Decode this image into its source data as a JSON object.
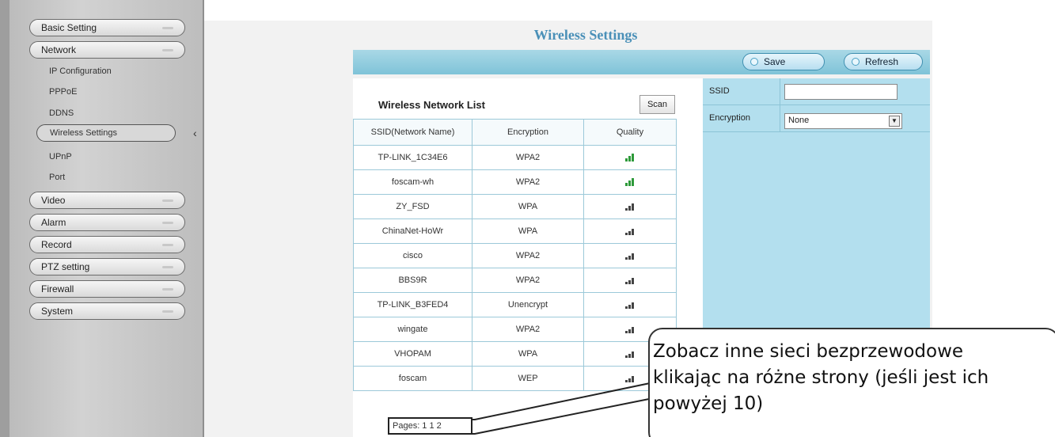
{
  "sidebar": {
    "menu": [
      {
        "label": "Basic Setting"
      },
      {
        "label": "Network"
      },
      {
        "label": "Video"
      },
      {
        "label": "Alarm"
      },
      {
        "label": "Record"
      },
      {
        "label": "PTZ setting"
      },
      {
        "label": "Firewall"
      },
      {
        "label": "System"
      }
    ],
    "network_sub": [
      {
        "label": "IP Configuration"
      },
      {
        "label": "PPPoE"
      },
      {
        "label": "DDNS"
      },
      {
        "label": "Wireless Settings"
      },
      {
        "label": "UPnP"
      },
      {
        "label": "Port"
      }
    ]
  },
  "main": {
    "title": "Wireless Settings",
    "toolbar": {
      "save_label": "Save",
      "refresh_label": "Refresh"
    }
  },
  "network_list": {
    "title": "Wireless Network List",
    "scan_label": "Scan",
    "columns": [
      "SSID(Network Name)",
      "Encryption",
      "Quality"
    ],
    "rows": [
      {
        "ssid": "TP-LINK_1C34E6",
        "encryption": "WPA2",
        "quality": "good"
      },
      {
        "ssid": "foscam-wh",
        "encryption": "WPA2",
        "quality": "good"
      },
      {
        "ssid": "ZY_FSD",
        "encryption": "WPA",
        "quality": "medium"
      },
      {
        "ssid": "ChinaNet-HoWr",
        "encryption": "WPA",
        "quality": "low"
      },
      {
        "ssid": "cisco",
        "encryption": "WPA2",
        "quality": "low"
      },
      {
        "ssid": "BBS9R",
        "encryption": "WPA2",
        "quality": "low"
      },
      {
        "ssid": "TP-LINK_B3FED4",
        "encryption": "Unencrypt",
        "quality": "low"
      },
      {
        "ssid": "wingate",
        "encryption": "WPA2",
        "quality": "low"
      },
      {
        "ssid": "VHOPAM",
        "encryption": "WPA",
        "quality": "low"
      },
      {
        "ssid": "foscam",
        "encryption": "WEP",
        "quality": "low"
      }
    ],
    "pager": "Pages: 1   1 2"
  },
  "settings": {
    "ssid_label": "SSID",
    "ssid_value": "",
    "encryption_label": "Encryption",
    "encryption_value": "None"
  },
  "callout": {
    "line1": "Zobacz inne sieci bezprzewodowe",
    "line2": "klikając na różne strony (jeśli jest ich",
    "line3": "powyżej 10)"
  },
  "colors": {
    "accent": "#4a90b8",
    "toolbar": "#8ccbe0",
    "panel": "#b3dfee",
    "quality_good": "#2e9a3a"
  }
}
